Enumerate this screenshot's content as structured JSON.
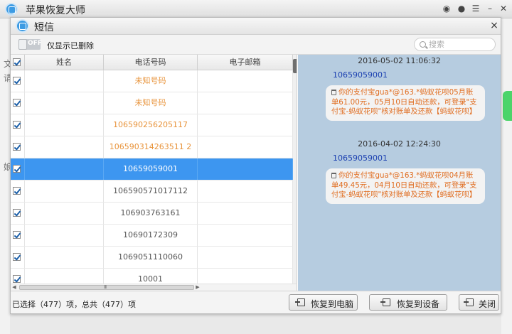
{
  "app": {
    "title": "苹果恢复大师",
    "controls": [
      "微博",
      "消息",
      "菜单",
      "最小化",
      "关闭"
    ]
  },
  "background_fragments": [
    "文",
    "请",
    "娘"
  ],
  "dialog": {
    "title": "短信",
    "close_label": "×",
    "toggle": {
      "state_text": "OFF",
      "label": "仅显示已删除"
    },
    "search": {
      "placeholder": "搜索"
    }
  },
  "table": {
    "columns": [
      "姓名",
      "电话号码",
      "电子邮箱"
    ],
    "rows": [
      {
        "name": "",
        "phone": "未知号码",
        "email": "",
        "checked": true,
        "selected": false,
        "orange": true
      },
      {
        "name": "",
        "phone": "未知号码",
        "email": "",
        "checked": true,
        "selected": false,
        "orange": true
      },
      {
        "name": "",
        "phone": "106590256205117",
        "email": "",
        "checked": true,
        "selected": false,
        "orange": true
      },
      {
        "name": "",
        "phone": "106590314263511 2",
        "email": "",
        "checked": true,
        "selected": false,
        "orange": true
      },
      {
        "name": "",
        "phone": "10659059001",
        "email": "",
        "checked": true,
        "selected": true,
        "orange": false
      },
      {
        "name": "",
        "phone": "106590571017112",
        "email": "",
        "checked": true,
        "selected": false,
        "orange": false
      },
      {
        "name": "",
        "phone": "106903763161",
        "email": "",
        "checked": true,
        "selected": false,
        "orange": false
      },
      {
        "name": "",
        "phone": "10690172309",
        "email": "",
        "checked": true,
        "selected": false,
        "orange": false
      },
      {
        "name": "",
        "phone": "1069051110060",
        "email": "",
        "checked": true,
        "selected": false,
        "orange": false
      },
      {
        "name": "",
        "phone": "10001",
        "email": "",
        "checked": true,
        "selected": false,
        "orange": false
      }
    ],
    "hscroll_grip": "III"
  },
  "messages": [
    {
      "date": "2016-05-02 11:06:32",
      "sender": "10659059001",
      "text": "你的支付宝gua*@163.*蚂蚁花呗05月账单61.00元，05月10日自动还款，可登录\"支付宝-蚂蚁花呗\"核对账单及还款【蚂蚁花呗】"
    },
    {
      "date": "2016-04-02 12:24:30",
      "sender": "10659059001",
      "text": "你的支付宝gua*@163.*蚂蚁花呗04月账单49.45元，04月10日自动还款，可登录\"支付宝-蚂蚁花呗\"核对账单及还款【蚂蚁花呗】"
    }
  ],
  "footer": {
    "status": "已选择（477）项，总共（477）项",
    "buttons": {
      "restore_pc": "恢复到电脑",
      "restore_device": "恢复到设备",
      "close": "关闭"
    }
  },
  "colors": {
    "selected_row": "#3d96f0",
    "orange_text": "#e8933a",
    "message_pane": "#b6cce0",
    "sender_text": "#1a3fb0"
  }
}
